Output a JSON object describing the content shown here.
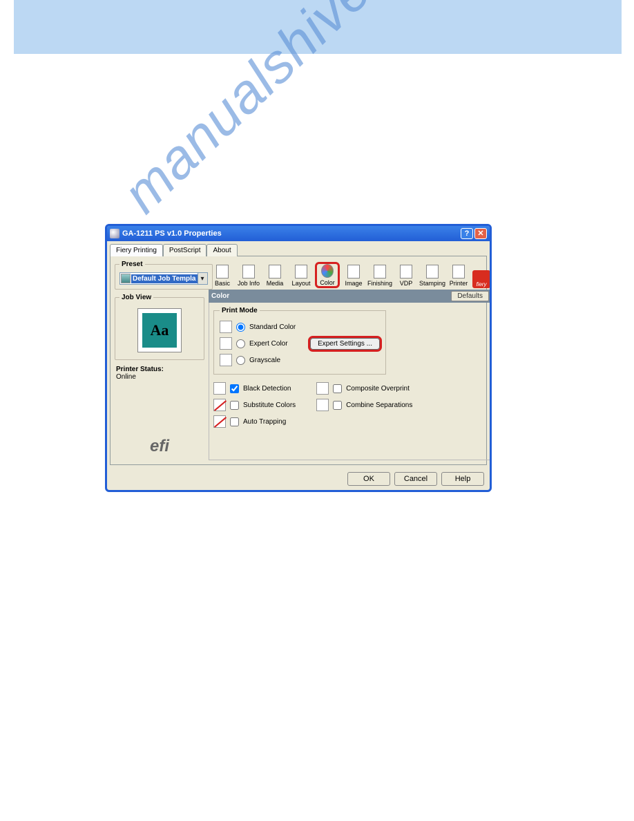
{
  "watermark": "manualshive.com",
  "dialog": {
    "title": "GA-1211 PS v1.0 Properties",
    "tabs": [
      {
        "label": "Fiery Printing",
        "active": true
      },
      {
        "label": "PostScript",
        "active": false
      },
      {
        "label": "About",
        "active": false
      }
    ],
    "preset": {
      "legend": "Preset",
      "value": "Default Job Templa"
    },
    "jobview": {
      "legend": "Job View",
      "sample": "Aa"
    },
    "printer_status": {
      "label": "Printer Status:",
      "value": "Online"
    },
    "efi_logo": "efi",
    "fiery_logo": "fiery",
    "toolbar": [
      {
        "label": "Basic"
      },
      {
        "label": "Job Info"
      },
      {
        "label": "Media"
      },
      {
        "label": "Layout"
      },
      {
        "label": "Color",
        "highlight": true
      },
      {
        "label": "Image"
      },
      {
        "label": "Finishing"
      },
      {
        "label": "VDP"
      },
      {
        "label": "Stamping"
      },
      {
        "label": "Printer"
      }
    ],
    "section": {
      "title": "Color",
      "defaults_btn": "Defaults"
    },
    "print_mode": {
      "legend": "Print Mode",
      "options": [
        {
          "label": "Standard Color",
          "checked": true
        },
        {
          "label": "Expert Color",
          "checked": false
        },
        {
          "label": "Grayscale",
          "checked": false
        }
      ],
      "expert_btn": "Expert Settings ..."
    },
    "checks_left": [
      {
        "label": "Black Detection",
        "checked": true
      },
      {
        "label": "Substitute Colors",
        "checked": false
      },
      {
        "label": "Auto Trapping",
        "checked": false
      }
    ],
    "checks_right": [
      {
        "label": "Composite Overprint",
        "checked": false
      },
      {
        "label": "Combine Separations",
        "checked": false
      }
    ],
    "buttons": {
      "ok": "OK",
      "cancel": "Cancel",
      "help": "Help"
    }
  }
}
